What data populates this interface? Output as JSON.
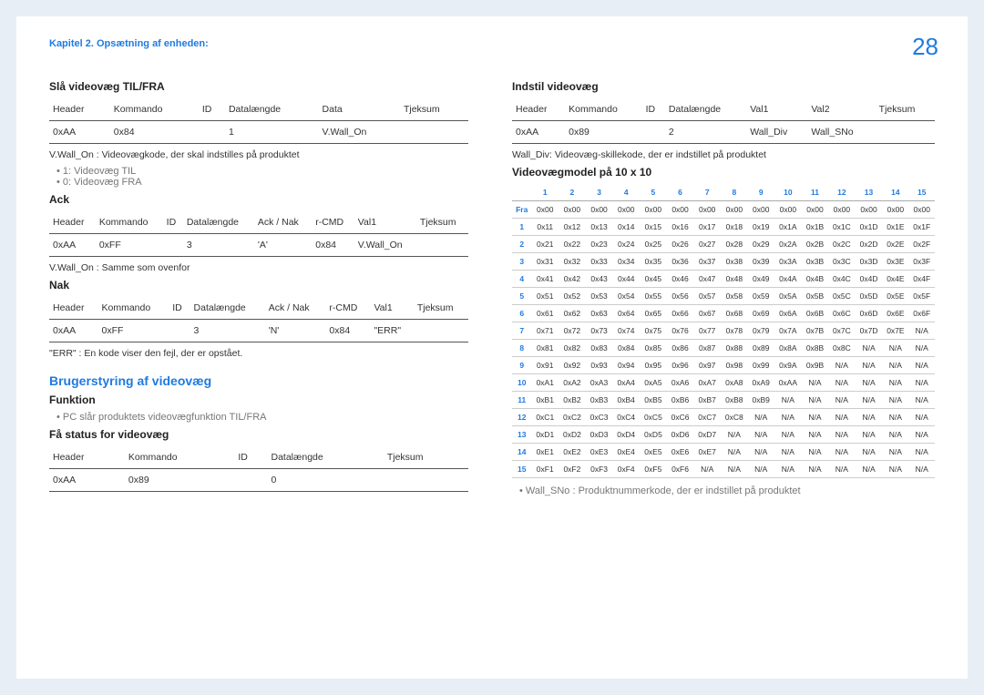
{
  "page_number": "28",
  "breadcrumb": "Kapitel 2. Opsætning af enheden:",
  "left": {
    "sec1_title": "Slå videovæg TIL/FRA",
    "t1_headers": [
      "Header",
      "Kommando",
      "ID",
      "Datalængde",
      "Data",
      "Tjeksum"
    ],
    "t1_row": [
      "0xAA",
      "0x84",
      "",
      "1",
      "V.Wall_On",
      ""
    ],
    "note1": "V.Wall_On : Videovægkode, der skal indstilles på produktet",
    "b1": "1: Videovæg TIL",
    "b2": "0: Videovæg FRA",
    "ack_title": "Ack",
    "t2_headers": [
      "Header",
      "Kommando",
      "ID",
      "Datalængde",
      "Ack / Nak",
      "r-CMD",
      "Val1",
      "Tjeksum"
    ],
    "t2_row": [
      "0xAA",
      "0xFF",
      "",
      "3",
      "'A'",
      "0x84",
      "V.Wall_On",
      ""
    ],
    "note2": "V.Wall_On : Samme som ovenfor",
    "nak_title": "Nak",
    "t3_row": [
      "0xAA",
      "0xFF",
      "",
      "3",
      "'N'",
      "0x84",
      "\"ERR\"",
      ""
    ],
    "note3": "\"ERR\" : En kode viser den fejl, der er opstået.",
    "h3": "Brugerstyring af videovæg",
    "funktion": "Funktion",
    "funk_b": "PC slår produktets videovægfunktion TIL/FRA",
    "status_title": "Få status for videovæg",
    "t4_headers": [
      "Header",
      "Kommando",
      "ID",
      "Datalængde",
      "Tjeksum"
    ],
    "t4_row": [
      "0xAA",
      "0x89",
      "",
      "0",
      ""
    ]
  },
  "right": {
    "sec_title": "Indstil videovæg",
    "t1_headers": [
      "Header",
      "Kommando",
      "ID",
      "Datalængde",
      "Val1",
      "Val2",
      "Tjeksum"
    ],
    "t1_row": [
      "0xAA",
      "0x89",
      "",
      "2",
      "Wall_Div",
      "Wall_SNo",
      ""
    ],
    "note1": "Wall_Div: Videovæg-skillekode, der er indstillet på produktet",
    "model_title": "Videovægmodel på 10 x 10",
    "note2": "Wall_SNo : Produktnummerkode, der er indstillet på produktet"
  },
  "chart_data": {
    "type": "table",
    "title": "Videovægmodel på 10 x 10",
    "col_headers": [
      "1",
      "2",
      "3",
      "4",
      "5",
      "6",
      "7",
      "8",
      "9",
      "10",
      "11",
      "12",
      "13",
      "14",
      "15"
    ],
    "row_headers": [
      "Fra",
      "1",
      "2",
      "3",
      "4",
      "5",
      "6",
      "7",
      "8",
      "9",
      "10",
      "11",
      "12",
      "13",
      "14",
      "15"
    ],
    "rows": [
      [
        "0x00",
        "0x00",
        "0x00",
        "0x00",
        "0x00",
        "0x00",
        "0x00",
        "0x00",
        "0x00",
        "0x00",
        "0x00",
        "0x00",
        "0x00",
        "0x00",
        "0x00"
      ],
      [
        "0x11",
        "0x12",
        "0x13",
        "0x14",
        "0x15",
        "0x16",
        "0x17",
        "0x18",
        "0x19",
        "0x1A",
        "0x1B",
        "0x1C",
        "0x1D",
        "0x1E",
        "0x1F"
      ],
      [
        "0x21",
        "0x22",
        "0x23",
        "0x24",
        "0x25",
        "0x26",
        "0x27",
        "0x28",
        "0x29",
        "0x2A",
        "0x2B",
        "0x2C",
        "0x2D",
        "0x2E",
        "0x2F"
      ],
      [
        "0x31",
        "0x32",
        "0x33",
        "0x34",
        "0x35",
        "0x36",
        "0x37",
        "0x38",
        "0x39",
        "0x3A",
        "0x3B",
        "0x3C",
        "0x3D",
        "0x3E",
        "0x3F"
      ],
      [
        "0x41",
        "0x42",
        "0x43",
        "0x44",
        "0x45",
        "0x46",
        "0x47",
        "0x48",
        "0x49",
        "0x4A",
        "0x4B",
        "0x4C",
        "0x4D",
        "0x4E",
        "0x4F"
      ],
      [
        "0x51",
        "0x52",
        "0x53",
        "0x54",
        "0x55",
        "0x56",
        "0x57",
        "0x58",
        "0x59",
        "0x5A",
        "0x5B",
        "0x5C",
        "0x5D",
        "0x5E",
        "0x5F"
      ],
      [
        "0x61",
        "0x62",
        "0x63",
        "0x64",
        "0x65",
        "0x66",
        "0x67",
        "0x68",
        "0x69",
        "0x6A",
        "0x6B",
        "0x6C",
        "0x6D",
        "0x6E",
        "0x6F"
      ],
      [
        "0x71",
        "0x72",
        "0x73",
        "0x74",
        "0x75",
        "0x76",
        "0x77",
        "0x78",
        "0x79",
        "0x7A",
        "0x7B",
        "0x7C",
        "0x7D",
        "0x7E",
        "N/A"
      ],
      [
        "0x81",
        "0x82",
        "0x83",
        "0x84",
        "0x85",
        "0x86",
        "0x87",
        "0x88",
        "0x89",
        "0x8A",
        "0x8B",
        "0x8C",
        "N/A",
        "N/A",
        "N/A"
      ],
      [
        "0x91",
        "0x92",
        "0x93",
        "0x94",
        "0x95",
        "0x96",
        "0x97",
        "0x98",
        "0x99",
        "0x9A",
        "0x9B",
        "N/A",
        "N/A",
        "N/A",
        "N/A"
      ],
      [
        "0xA1",
        "0xA2",
        "0xA3",
        "0xA4",
        "0xA5",
        "0xA6",
        "0xA7",
        "0xA8",
        "0xA9",
        "0xAA",
        "N/A",
        "N/A",
        "N/A",
        "N/A",
        "N/A"
      ],
      [
        "0xB1",
        "0xB2",
        "0xB3",
        "0xB4",
        "0xB5",
        "0xB6",
        "0xB7",
        "0xB8",
        "0xB9",
        "N/A",
        "N/A",
        "N/A",
        "N/A",
        "N/A",
        "N/A"
      ],
      [
        "0xC1",
        "0xC2",
        "0xC3",
        "0xC4",
        "0xC5",
        "0xC6",
        "0xC7",
        "0xC8",
        "N/A",
        "N/A",
        "N/A",
        "N/A",
        "N/A",
        "N/A",
        "N/A"
      ],
      [
        "0xD1",
        "0xD2",
        "0xD3",
        "0xD4",
        "0xD5",
        "0xD6",
        "0xD7",
        "N/A",
        "N/A",
        "N/A",
        "N/A",
        "N/A",
        "N/A",
        "N/A",
        "N/A"
      ],
      [
        "0xE1",
        "0xE2",
        "0xE3",
        "0xE4",
        "0xE5",
        "0xE6",
        "0xE7",
        "N/A",
        "N/A",
        "N/A",
        "N/A",
        "N/A",
        "N/A",
        "N/A",
        "N/A"
      ],
      [
        "0xF1",
        "0xF2",
        "0xF3",
        "0xF4",
        "0xF5",
        "0xF6",
        "N/A",
        "N/A",
        "N/A",
        "N/A",
        "N/A",
        "N/A",
        "N/A",
        "N/A",
        "N/A"
      ]
    ]
  }
}
